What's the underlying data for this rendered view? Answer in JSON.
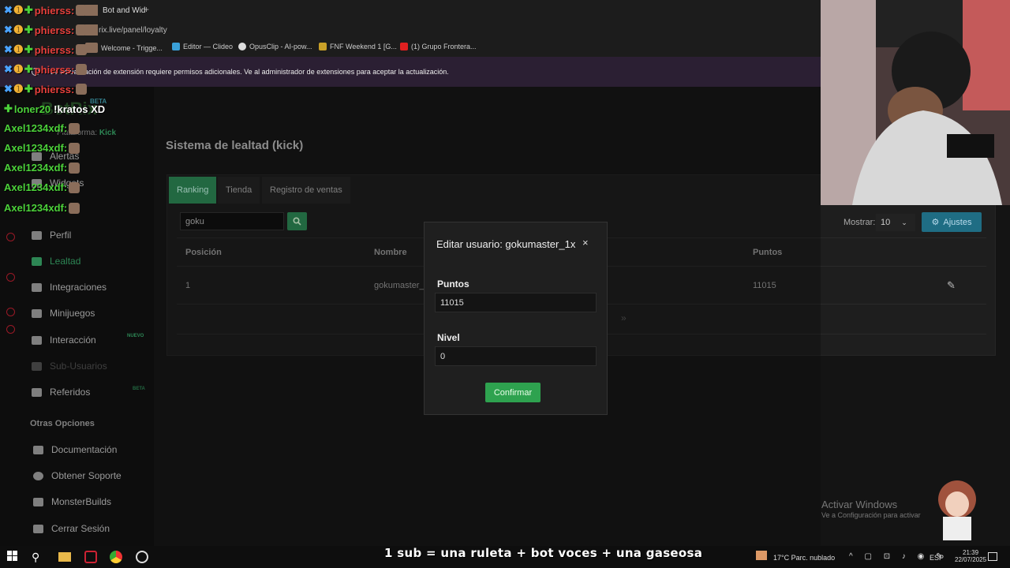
{
  "browser": {
    "tab_active": "Bot and Wid",
    "new_tab": "+",
    "url": "rix.live/panel/loyalty",
    "bookmarks": [
      "Welcome - Trigge...",
      "Editor — Clideo",
      "OpusClip - AI-pow...",
      "FNF Weekend 1 [G...",
      "(1) Grupo Frontera..."
    ],
    "infobar_text": "La actualización de extensión requiere permisos adicionales. Ve al administrador de extensiones para aceptar la actualización."
  },
  "sidebar": {
    "logo": "BotRix",
    "logo_badge": "BETA",
    "platform_label": "Plataforma:",
    "platform_value": "Kick",
    "items": [
      "Alertas",
      "Widgets",
      "Perfil",
      "Lealtad",
      "Integraciones",
      "Minijuegos",
      "Interacción",
      "Sub-Usuarios",
      "Referidos"
    ],
    "badges": {
      "interaccion": "NUEVO",
      "referidos": "BETA"
    },
    "other_heading": "Otras Opciones",
    "other_items": [
      "Documentación",
      "Obtener Soporte",
      "MonsterBuilds",
      "Cerrar Sesión"
    ]
  },
  "main": {
    "title": "Sistema de lealtad (kick)",
    "tabs": [
      "Ranking",
      "Tienda",
      "Registro de ventas"
    ],
    "search_value": "goku",
    "show_label": "Mostrar:",
    "show_value": "10",
    "settings_label": "Ajustes",
    "table": {
      "headers": [
        "Posición",
        "Nombre",
        "Puntos"
      ],
      "rows": [
        {
          "position": "1",
          "name": "gokumaster_1",
          "points": "11015"
        }
      ]
    },
    "pager_next": "»"
  },
  "modal": {
    "title": "Editar usuario: gokumaster_1x",
    "close": "×",
    "field1_label": "Puntos",
    "field1_value": "11015",
    "field2_label": "Nivel",
    "field2_value": "0",
    "confirm_label": "Confirmar"
  },
  "chat": [
    {
      "user": "phierss:",
      "color": "#e8403c"
    },
    {
      "user": "phierss:",
      "color": "#e8403c"
    },
    {
      "user": "phierss:",
      "color": "#e8403c"
    },
    {
      "user": "phierss:",
      "color": "#e8403c"
    },
    {
      "user": "phierss:",
      "color": "#e8403c"
    },
    {
      "user": "loner20",
      "message": "!kratos XD",
      "color": "#4cd23a"
    },
    {
      "user": "Axel1234xdf:",
      "color": "#4cd23a"
    },
    {
      "user": "Axel1234xdf:",
      "color": "#4cd23a"
    },
    {
      "user": "Axel1234xdf:",
      "color": "#4cd23a"
    },
    {
      "user": "Axel1234xdf:",
      "color": "#4cd23a"
    },
    {
      "user": "Axel1234xdf:",
      "color": "#4cd23a"
    }
  ],
  "watermark": {
    "line1": "Activar Windows",
    "line2": "Ve a Configuración para activar"
  },
  "stream_subtitle": "1 sub = una ruleta + bot voces + una gaseosa",
  "taskbar": {
    "weather": "17°C  Parc. nublado",
    "lang": "ESP",
    "time": "21:39",
    "date": "22/07/2025"
  },
  "colors": {
    "accent": "#2e8b57",
    "confirm": "#2ea24f",
    "settings": "#1f6d84",
    "chat_red": "#e8403c",
    "chat_green": "#4cd23a"
  }
}
